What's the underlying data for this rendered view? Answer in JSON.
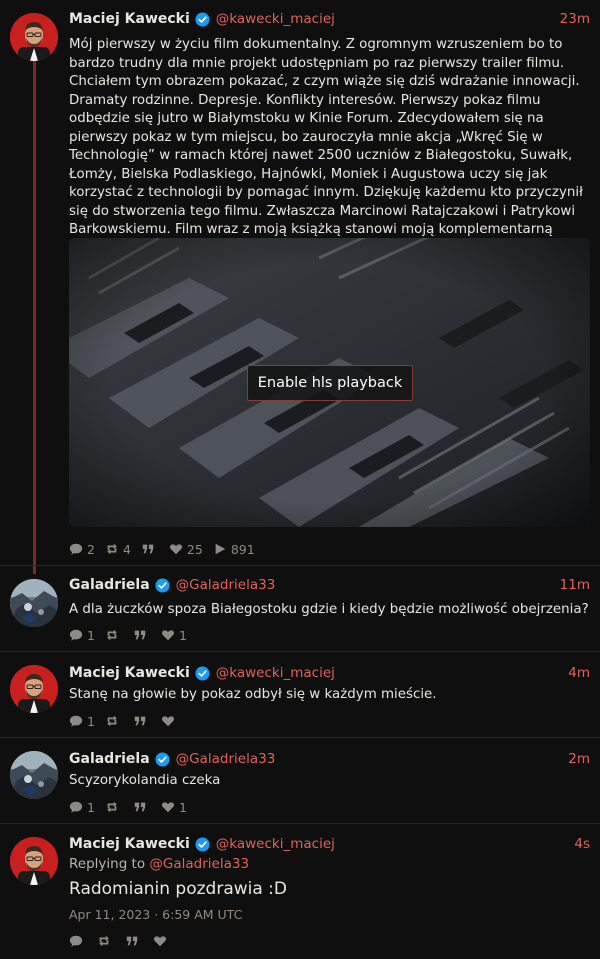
{
  "tweets": [
    {
      "fullname": "Maciej Kawecki",
      "username": "@kawecki_maciej",
      "time": "23m",
      "text": "Mój pierwszy w życiu film dokumentalny. Z ogromnym wzruszeniem bo to bardzo trudny dla mnie projekt udostępniam po raz pierwszy trailer filmu. Chciałem tym obrazem pokazać, z czym wiąże się dziś wdrażanie innowacji. Dramaty rodzinne. Depresje. Konflikty interesów. Pierwszy pokaz filmu odbędzie się jutro w Białymstoku w Kinie Forum. Zdecydowałem się na pierwszy pokaz w tym miejscu, bo zauroczyła mnie akcja „Wkręć Się w Technologię” w ramach której nawet 2500 uczniów z Białegostoku, Suwałk, Łomży, Bielska Podlaskiego, Hajnówki, Moniek i Augustowa uczy się jak korzystać z technologii by pomagać innym. Dziękuję każdemu kto przyczynił się do stworzenia tego filmu. Zwłaszcza Marcinowi Ratajczakowi i Patrykowi Barkowskiemu. Film wraz z moją książką stanowi moją komplementarną opowieść o świecie, który sam się wyniszcza.",
      "video_button": "Enable hls playback",
      "stats": {
        "replies": "2",
        "retweets": "4",
        "likes": "25",
        "views": "891"
      }
    },
    {
      "fullname": "Galadriela",
      "username": "@Galadriela33",
      "time": "11m",
      "text": "A dla żuczków spoza Białegostoku gdzie i kiedy będzie możliwość obejrzenia?",
      "stats": {
        "replies": "1",
        "likes": "1"
      }
    },
    {
      "fullname": "Maciej Kawecki",
      "username": "@kawecki_maciej",
      "time": "4m",
      "text": "Stanę na głowie by pokaz odbył się w każdym mieście.",
      "stats": {
        "replies": "1"
      }
    },
    {
      "fullname": "Galadriela",
      "username": "@Galadriela33",
      "time": "2m",
      "text": "Scyzorykolandia czeka",
      "stats": {
        "replies": "1",
        "likes": "1"
      }
    },
    {
      "fullname": "Maciej Kawecki",
      "username": "@kawecki_maciej",
      "time": "4s",
      "replying_prefix": "Replying to ",
      "replying_user": "@Galadriela33",
      "text": "Radomianin pozdrawia :D",
      "date": "Apr 11, 2023 · 6:59 AM UTC"
    }
  ],
  "colors": {
    "accent": "#e2625b",
    "background": "#0f0f0f",
    "verified": "#1d9bf0",
    "thread_line": "#7a2a2a"
  },
  "icons": [
    "verified-badge-icon",
    "reply-icon",
    "retweet-icon",
    "quote-icon",
    "like-icon",
    "views-icon"
  ]
}
